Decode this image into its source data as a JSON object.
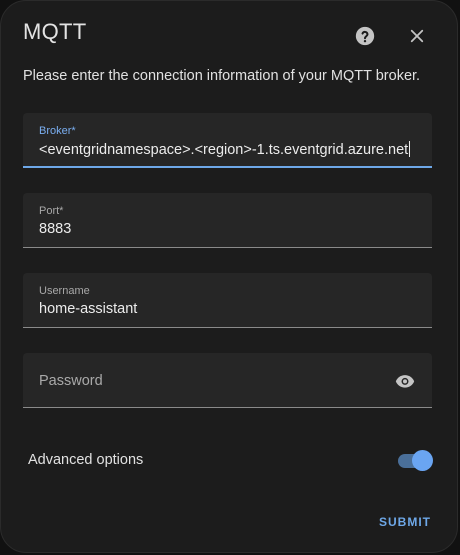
{
  "dialog": {
    "title": "MQTT",
    "description": "Please enter the connection information of your MQTT broker."
  },
  "icons": {
    "help": "help-circle-icon",
    "close": "close-icon",
    "visibility": "eye-icon"
  },
  "fields": {
    "broker": {
      "label": "Broker*",
      "value": "<eventgridnamespace>.<region>-1.ts.eventgrid.azure.net"
    },
    "port": {
      "label": "Port*",
      "value": "8883"
    },
    "username": {
      "label": "Username",
      "value": "home-assistant"
    },
    "password": {
      "placeholder": "Password"
    }
  },
  "advanced": {
    "label": "Advanced options",
    "enabled": true
  },
  "actions": {
    "submit_label": "SUBMIT"
  },
  "colors": {
    "accent": "#6ea8e8",
    "surface": "#1c1c1c",
    "field_background": "#262626"
  }
}
